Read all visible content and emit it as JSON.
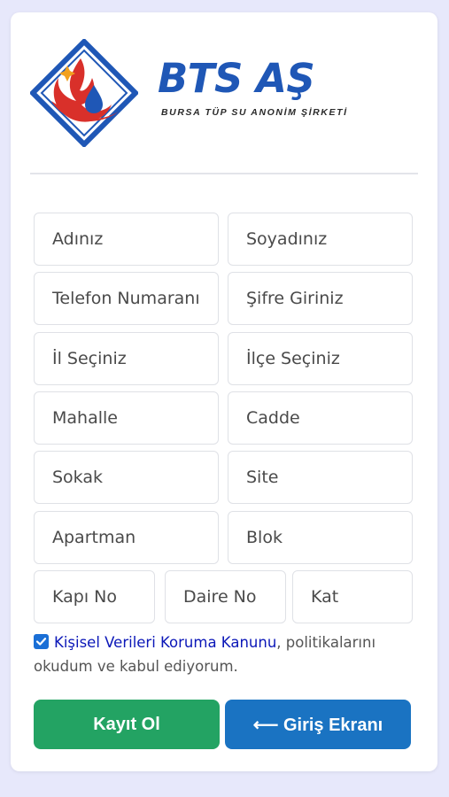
{
  "brand": {
    "title": "BTS AŞ",
    "subtitle": "BURSA TÜP SU ANONİM ŞİRKETİ"
  },
  "form": {
    "first_name": "Adınız",
    "last_name": "Soyadınız",
    "phone": "Telefon Numaranı",
    "password": "Şifre Giriniz",
    "city": "İl Seçiniz",
    "district": "İlçe Seçiniz",
    "neighborhood": "Mahalle",
    "avenue": "Cadde",
    "street": "Sokak",
    "site": "Site",
    "apartment": "Apartman",
    "block": "Blok",
    "door_no": "Kapı No",
    "flat_no": "Daire No",
    "floor": "Kat"
  },
  "consent": {
    "checked": true,
    "link_text": "Kişisel Verileri Koruma Kanunu",
    "text": ", politikalarını okudum ve kabul ediyorum."
  },
  "buttons": {
    "register": "Kayıt Ol",
    "login": "⟵ Giriş Ekranı"
  },
  "colors": {
    "background": "#e7e8fb",
    "brand_blue": "#1f57b6",
    "brand_red": "#d9302a",
    "register_green": "#23a363",
    "login_blue": "#1a73c2",
    "link": "#0b17b8"
  },
  "icons": {
    "logo": "bts-logo-icon",
    "checkbox": "checkbox-checked-icon"
  }
}
